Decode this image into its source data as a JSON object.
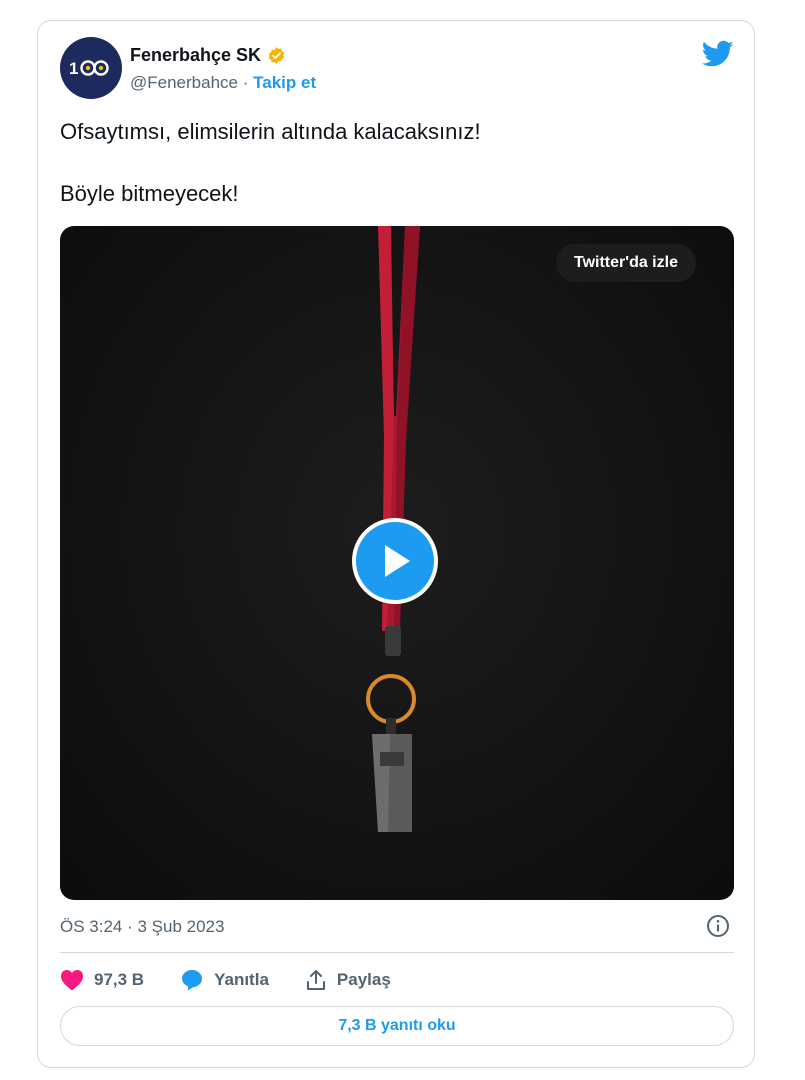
{
  "account": {
    "name": "Fenerbahçe SK",
    "handle": "@Fenerbahce",
    "separator": "·",
    "follow_label": "Takip et",
    "avatar_text": "100",
    "verified_badge_color": "#f4b400"
  },
  "tweet": {
    "line1": "Ofsaytımsı, elimsilerin altında kalacaksınız!",
    "line2": "Böyle bitmeyecek!",
    "timestamp": "ÖS 3:24 · 3 Şub 2023"
  },
  "media": {
    "watch_label": "Twitter'da izle",
    "icon": "play-icon",
    "subject": "whistle-on-lanyard"
  },
  "actions": {
    "likes": "97,3 B",
    "reply_label": "Yanıtla",
    "share_label": "Paylaş"
  },
  "read_replies_label": "7,3 B yanıtı oku",
  "colors": {
    "accent": "#1d9bf0",
    "like": "#f91880",
    "secondary_text": "#536471",
    "border": "#cfd9de"
  }
}
